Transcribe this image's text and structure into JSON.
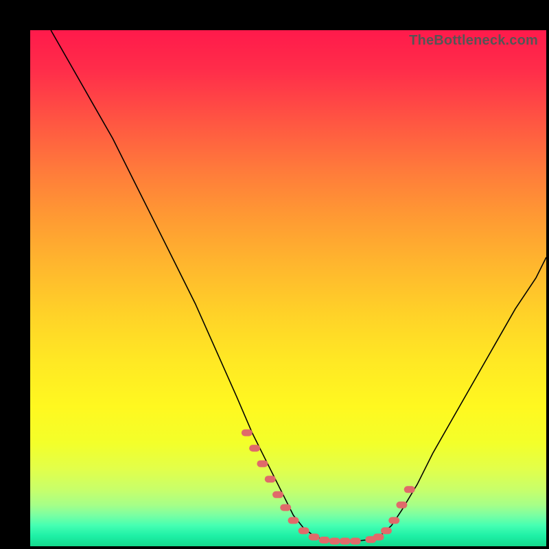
{
  "watermark": "TheBottleneck.com",
  "colors": {
    "marker": "#e06a6a",
    "curve": "#000000",
    "gradient_top": "#ff1a4b",
    "gradient_bottom": "#15d98c"
  },
  "chart_data": {
    "type": "line",
    "title": "",
    "xlabel": "",
    "ylabel": "",
    "xlim": [
      0,
      100
    ],
    "ylim": [
      0,
      100
    ],
    "grid": false,
    "legend": false,
    "series": [
      {
        "name": "bottleneck-curve",
        "x": [
          4,
          8,
          12,
          16,
          20,
          24,
          28,
          32,
          36,
          40,
          43,
          46,
          49,
          51,
          53,
          55,
          57,
          60,
          63,
          66,
          68,
          70,
          72,
          75,
          78,
          82,
          86,
          90,
          94,
          98,
          100
        ],
        "y": [
          100,
          93,
          86,
          79,
          71,
          63,
          55,
          47,
          38,
          29,
          22,
          16,
          10,
          6,
          3.5,
          2,
          1.2,
          1,
          1,
          1.3,
          2.2,
          4,
          7,
          12,
          18,
          25,
          32,
          39,
          46,
          52,
          56
        ]
      }
    ],
    "markers": {
      "name": "highlight-points",
      "x": [
        42,
        43.5,
        45,
        46.5,
        48,
        49.5,
        51,
        53,
        55,
        57,
        59,
        61,
        63,
        66,
        67.5,
        69,
        70.5,
        72,
        73.5
      ],
      "y": [
        22,
        19,
        16,
        13,
        10,
        7.5,
        5,
        3,
        1.8,
        1.2,
        1,
        1,
        1,
        1.3,
        1.8,
        3,
        5,
        8,
        11
      ]
    }
  }
}
